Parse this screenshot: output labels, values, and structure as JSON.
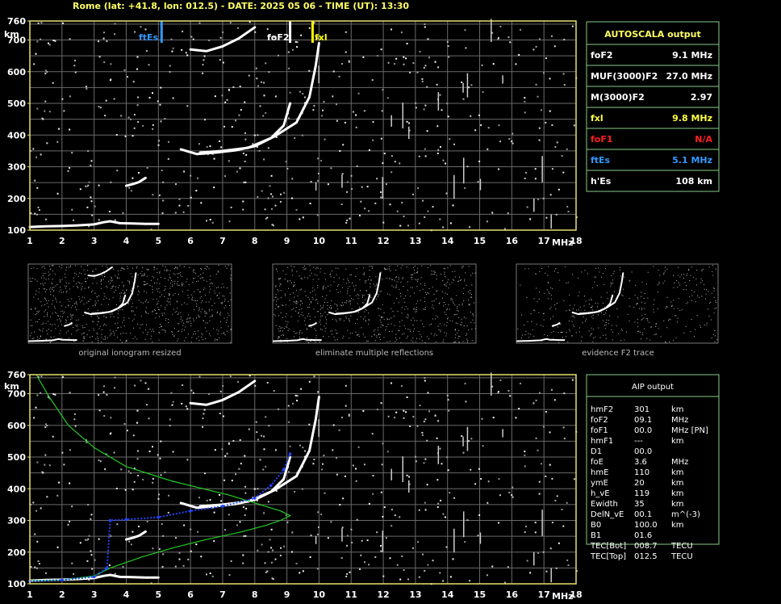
{
  "header": {
    "title": "Rome (lat: +41.8, lon: 012.5) - DATE: 2025 05 06 - TIME (UT): 13:30"
  },
  "colors": {
    "frame": "#e8e070",
    "grid": "#6a6a6a",
    "green_line": "#88cc88",
    "fxl": "#ffff00",
    "fof1": "#ff2020",
    "ftes": "#3399ff",
    "model": "#22cc22",
    "profile": "#2244ff"
  },
  "axes": {
    "km_label": "km",
    "mhz_label": "MHz",
    "x_ticks": [
      "1",
      "2",
      "3",
      "4",
      "5",
      "6",
      "7",
      "8",
      "9",
      "10",
      "11",
      "12",
      "13",
      "14",
      "15",
      "16",
      "17",
      "18"
    ],
    "y_ticks": [
      "100",
      "200",
      "300",
      "400",
      "500",
      "600",
      "700",
      "760"
    ]
  },
  "top_plot_labels": {
    "ftes": "ftEs",
    "fof2": "foF2",
    "fxl": "fxl"
  },
  "autoscala": {
    "title": "AUTOSCALA output",
    "rows": [
      {
        "label": "foF2",
        "value": "9.1 MHz",
        "color": "#ffffff"
      },
      {
        "label": "MUF(3000)F2",
        "value": "27.0 MHz",
        "color": "#ffffff"
      },
      {
        "label": "M(3000)F2",
        "value": "2.97",
        "color": "#ffffff"
      },
      {
        "label": "fxl",
        "value": "9.8 MHz",
        "color": "#ffff44"
      },
      {
        "label": "foF1",
        "value": "N/A",
        "color": "#ff2020"
      },
      {
        "label": "ftEs",
        "value": "5.1 MHz",
        "color": "#3399ff"
      },
      {
        "label": "h'Es",
        "value": "108    km",
        "color": "#ffffff"
      }
    ]
  },
  "captions": {
    "first": "original ionogram resized",
    "second": "eliminate multiple reflections",
    "third": "evidence F2 trace"
  },
  "aip": {
    "title": "AIP output",
    "rows": [
      {
        "k": "hmF2",
        "v": "301",
        "u": "km"
      },
      {
        "k": "foF2",
        "v": "09.1",
        "u": "MHz"
      },
      {
        "k": "foF1",
        "v": "00.0",
        "u": "MHz    [PN]"
      },
      {
        "k": "hmF1",
        "v": "---",
        "u": "km"
      },
      {
        "k": "D1",
        "v": "00.0",
        "u": ""
      },
      {
        "k": "foE",
        "v": "3.6",
        "u": "MHz"
      },
      {
        "k": "hmE",
        "v": "110",
        "u": "km"
      },
      {
        "k": "ymE",
        "v": "20",
        "u": "km"
      },
      {
        "k": "h_vE",
        "v": "119",
        "u": "km"
      },
      {
        "k": "Ewidth",
        "v": "35",
        "u": "km"
      },
      {
        "k": "DelN_vE",
        "v": "00.1",
        "u": "m^(-3)"
      },
      {
        "k": "B0",
        "v": "100.0",
        "u": "km"
      },
      {
        "k": "B1",
        "v": "01.6",
        "u": ""
      },
      {
        "k": "TEC[Bot]",
        "v": "008.7",
        "u": "TECU"
      },
      {
        "k": "TEC[Top]",
        "v": "012.5",
        "u": "TECU"
      }
    ]
  },
  "chart_data": [
    {
      "type": "scatter",
      "name_ref": "top-ionogram",
      "xlim": [
        1,
        18
      ],
      "ylim": [
        100,
        760
      ],
      "grid": true,
      "traces": [
        {
          "series": "E-layer",
          "points": [
            [
              1.0,
              110
            ],
            [
              1.5,
              112
            ],
            [
              2.0,
              113
            ],
            [
              2.5,
              115
            ],
            [
              3.0,
              118
            ],
            [
              3.3,
              125
            ],
            [
              3.5,
              128
            ],
            [
              3.8,
              122
            ],
            [
              4.2,
              121
            ],
            [
              4.6,
              120
            ],
            [
              5.0,
              120
            ]
          ]
        },
        {
          "series": "Es-segment",
          "points": [
            [
              4.0,
              240
            ],
            [
              4.2,
              245
            ],
            [
              4.4,
              252
            ],
            [
              4.6,
              265
            ]
          ]
        },
        {
          "series": "F2-o",
          "points": [
            [
              5.7,
              355
            ],
            [
              6.2,
              340
            ],
            [
              6.8,
              345
            ],
            [
              7.4,
              352
            ],
            [
              8.0,
              365
            ],
            [
              8.5,
              390
            ],
            [
              8.9,
              430
            ],
            [
              9.1,
              500
            ]
          ]
        },
        {
          "series": "F2-x",
          "points": [
            [
              6.3,
              345
            ],
            [
              7.0,
              350
            ],
            [
              7.8,
              360
            ],
            [
              8.6,
              395
            ],
            [
              9.3,
              440
            ],
            [
              9.7,
              520
            ],
            [
              9.9,
              620
            ],
            [
              10.0,
              690
            ]
          ]
        },
        {
          "series": "F2-multiple",
          "points": [
            [
              6.0,
              670
            ],
            [
              6.5,
              665
            ],
            [
              7.0,
              680
            ],
            [
              7.5,
              705
            ],
            [
              8.0,
              740
            ]
          ]
        }
      ],
      "markers": [
        {
          "label": "ftEs",
          "x": 5.1
        },
        {
          "label": "foF2",
          "x": 9.1
        },
        {
          "label": "fxl",
          "x": 9.8
        }
      ]
    },
    {
      "type": "line",
      "name_ref": "aip-ionogram",
      "xlim": [
        1,
        18
      ],
      "ylim": [
        100,
        760
      ],
      "grid": true,
      "model_curve": [
        [
          1.0,
          110
        ],
        [
          2.0,
          112
        ],
        [
          3.0,
          125
        ],
        [
          3.5,
          150
        ],
        [
          4.5,
          185
        ],
        [
          5.5,
          215
        ],
        [
          6.5,
          240
        ],
        [
          7.5,
          262
        ],
        [
          8.3,
          283
        ],
        [
          8.8,
          300
        ],
        [
          9.1,
          315
        ],
        [
          8.8,
          330
        ],
        [
          8.0,
          355
        ],
        [
          7.2,
          380
        ],
        [
          6.4,
          400
        ],
        [
          5.4,
          425
        ],
        [
          4.0,
          470
        ],
        [
          3.0,
          530
        ],
        [
          2.2,
          600
        ],
        [
          1.6,
          690
        ],
        [
          1.2,
          760
        ]
      ],
      "profile_points": [
        [
          1.0,
          108
        ],
        [
          2.0,
          112
        ],
        [
          3.0,
          122
        ],
        [
          3.4,
          150
        ],
        [
          3.5,
          300
        ],
        [
          4.0,
          303
        ],
        [
          5.0,
          310
        ],
        [
          6.0,
          330
        ],
        [
          7.0,
          345
        ],
        [
          8.0,
          370
        ],
        [
          8.5,
          410
        ],
        [
          8.9,
          460
        ],
        [
          9.1,
          510
        ]
      ]
    }
  ]
}
